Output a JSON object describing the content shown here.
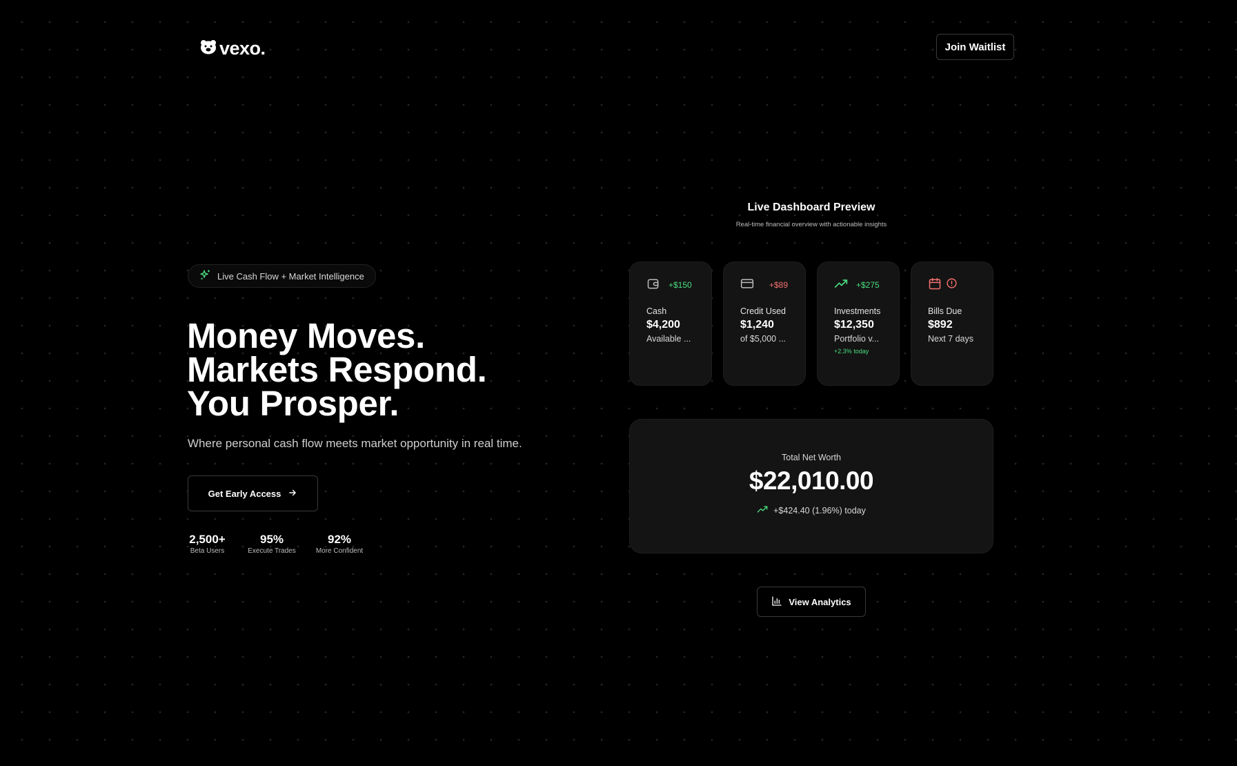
{
  "header": {
    "logo_text": "vexo.",
    "join_label": "Join Waitlist"
  },
  "hero": {
    "badge": "Live Cash Flow + Market Intelligence",
    "headline": [
      "Money Moves.",
      "Markets Respond.",
      "You Prosper."
    ],
    "subhead": "Where personal cash flow meets market opportunity in real time.",
    "cta_label": "Get Early Access",
    "stats": [
      {
        "value": "2,500+",
        "label": "Beta Users"
      },
      {
        "value": "95%",
        "label": "Execute Trades"
      },
      {
        "value": "92%",
        "label": "More Confident"
      }
    ]
  },
  "dashboard": {
    "title": "Live Dashboard Preview",
    "subtitle": "Real-time financial overview with actionable insights",
    "cards": [
      {
        "icon": "wallet-icon",
        "delta": "+$150",
        "label": "Cash",
        "value": "$4,200",
        "note": "Available ..."
      },
      {
        "icon": "credit-card-icon",
        "delta": "+$89",
        "label": "Credit Used",
        "value": "$1,240",
        "note": "of $5,000 ..."
      },
      {
        "icon": "trending-up-icon",
        "delta": "+$275",
        "label": "Investments",
        "value": "$12,350",
        "note": "Portfolio v...",
        "extra": "+2.3% today"
      },
      {
        "icon": "calendar-icon",
        "label": "Bills Due",
        "value": "$892",
        "note": "Next 7 days"
      }
    ],
    "net_worth": {
      "label": "Total Net Worth",
      "value": "$22,010.00",
      "change": "+$424.40 (1.96%) today"
    },
    "analytics_label": "View Analytics"
  },
  "colors": {
    "positive": "#4ade80",
    "negative": "#f87171",
    "card_bg": "#141414"
  }
}
